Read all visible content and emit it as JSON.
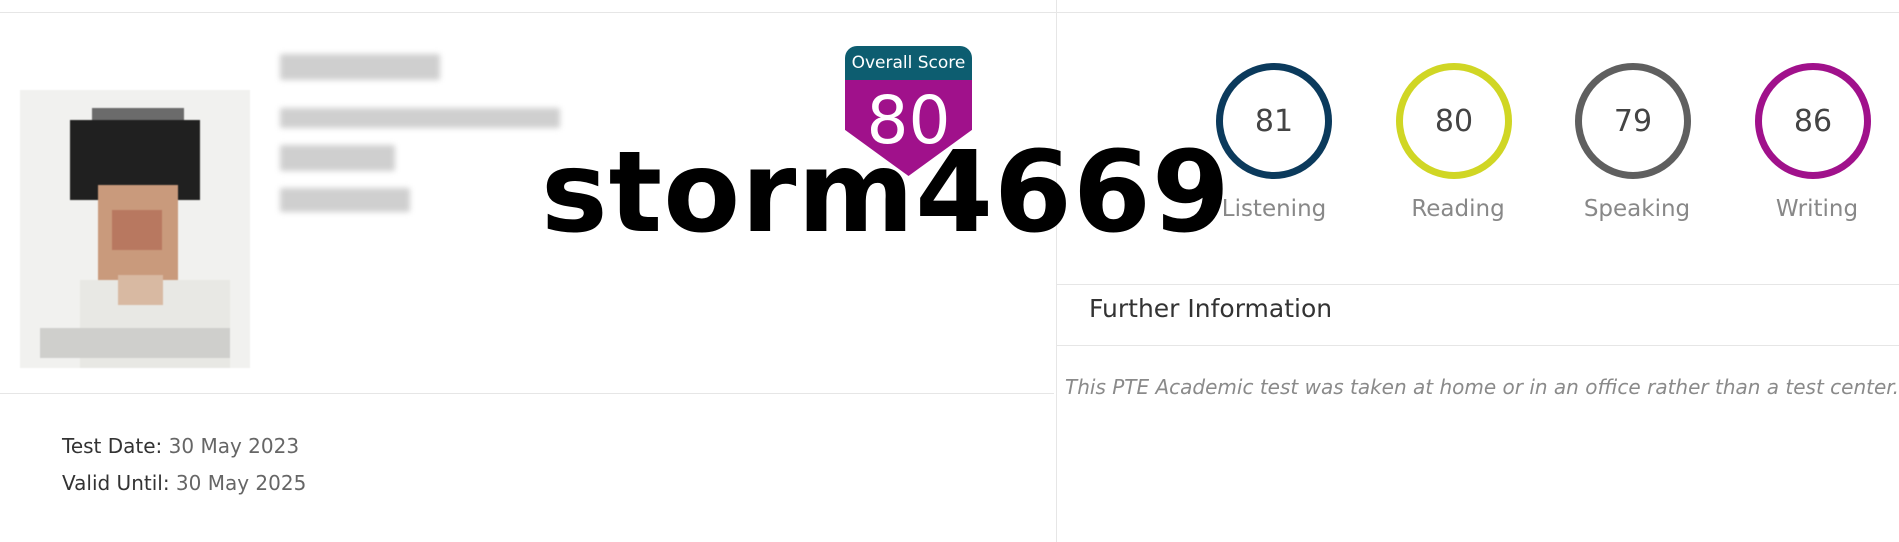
{
  "overall": {
    "label": "Overall Score",
    "value": "80"
  },
  "watermark": "storm4669",
  "skills": [
    {
      "name": "Listening",
      "value": "81",
      "color": "#0b3a5c"
    },
    {
      "name": "Reading",
      "value": "80",
      "color": "#d0d624"
    },
    {
      "name": "Speaking",
      "value": "79",
      "color": "#5f5f5f"
    },
    {
      "name": "Writing",
      "value": "86",
      "color": "#a0118b"
    }
  ],
  "further": {
    "title": "Further Information",
    "text": "This PTE Academic test was taken at home or in an office rather than a test center."
  },
  "dates": {
    "test_label": "Test Date:",
    "test_value": "30 May 2023",
    "valid_label": "Valid Until:",
    "valid_value": "30 May 2025"
  },
  "colors": {
    "overall_header": "#0d5d70",
    "overall_body": "#a0118b"
  }
}
